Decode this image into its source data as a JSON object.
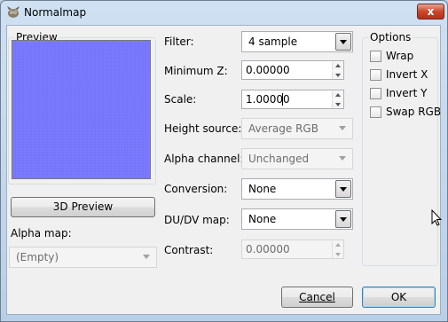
{
  "window": {
    "title": "Normalmap",
    "close_glyph": "x"
  },
  "preview": {
    "group_label": "Preview",
    "color": "#7b7bff"
  },
  "buttons": {
    "preview_3d": "3D Preview",
    "cancel": "Cancel",
    "ok": "OK"
  },
  "alpha_map": {
    "label": "Alpha map:",
    "value": "(Empty)"
  },
  "fields": {
    "filter": {
      "label": "Filter:",
      "value": "4 sample"
    },
    "minimum_z": {
      "label": "Minimum Z:",
      "value": "0.00000"
    },
    "scale": {
      "label": "Scale:",
      "value": "1.00000"
    },
    "height_source": {
      "label": "Height source:",
      "value": "Average RGB"
    },
    "alpha_channel": {
      "label": "Alpha channel:",
      "value": "Unchanged"
    },
    "conversion": {
      "label": "Conversion:",
      "value": "None"
    },
    "dudv_map": {
      "label": "DU/DV map:",
      "value": "None"
    },
    "contrast": {
      "label": "Contrast:",
      "value": "0.00000"
    }
  },
  "options": {
    "group_label": "Options",
    "items": [
      {
        "label": "Wrap",
        "checked": false
      },
      {
        "label": "Invert X",
        "checked": false
      },
      {
        "label": "Invert Y",
        "checked": false
      },
      {
        "label": "Swap RGB",
        "checked": false
      }
    ]
  }
}
